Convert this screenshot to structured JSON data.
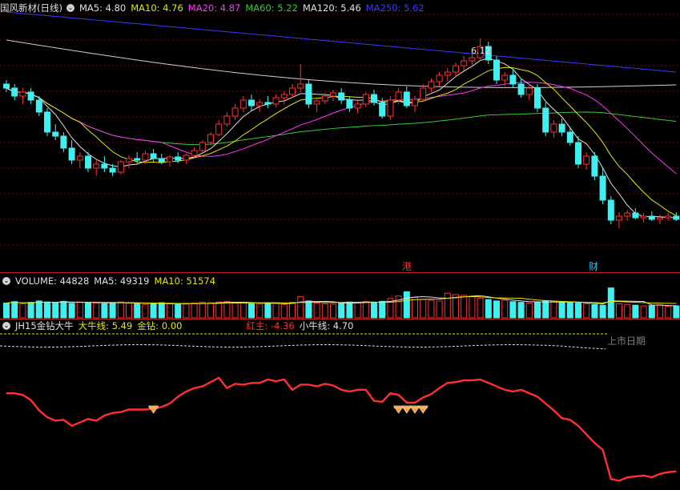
{
  "main": {
    "stock_title": "国风新材(日线)",
    "ma_items": [
      {
        "label": "MA5: 4.80",
        "color": "#e0e0e0"
      },
      {
        "label": "MA10: 4.76",
        "color": "#e6e600"
      },
      {
        "label": "MA20: 4.87",
        "color": "#ff33ff"
      },
      {
        "label": "MA60: 5.22",
        "color": "#33cc33"
      },
      {
        "label": "MA120: 5.46",
        "color": "#e0e0e0"
      },
      {
        "label": "MA250: 5.62",
        "color": "#3a3aff"
      }
    ],
    "price_annotation": "6.12",
    "event_markers": [
      {
        "text": "港",
        "color": "#ff3030",
        "x": 508
      },
      {
        "text": "财",
        "color": "#20c0ff",
        "x": 741
      }
    ]
  },
  "volume": {
    "items": [
      {
        "label": "VOLUME: 44828",
        "color": "#e0e0e0"
      },
      {
        "label": "MA5: 49319",
        "color": "#e0e0e0"
      },
      {
        "label": "MA10: 51574",
        "color": "#e6e600"
      }
    ]
  },
  "indicator": {
    "title": "JH15金钻大牛",
    "items": [
      {
        "label": "大牛线: 5.49",
        "color": "#e6e600"
      },
      {
        "label": "金钻: 0.00",
        "color": "#e6e600"
      },
      {
        "label": "红主: -4.36",
        "color": "#ff3030"
      },
      {
        "label": "小牛线: 4.70",
        "color": "#e0e0e0"
      }
    ],
    "listing_label": "上市日期"
  },
  "colors": {
    "up": "#ff3030",
    "down": "#40f0f0",
    "grid": "#8b0000",
    "separator": "#c02020"
  },
  "chart_data": [
    {
      "type": "candlestick",
      "title": "国风新材(日线)",
      "note": "daily candles, values in price units (yuan); index = trading day",
      "ohlc": [
        [
          5.55,
          5.6,
          5.45,
          5.5
        ],
        [
          5.5,
          5.55,
          5.35,
          5.4
        ],
        [
          5.4,
          5.5,
          5.3,
          5.45
        ],
        [
          5.45,
          5.5,
          5.3,
          5.35
        ],
        [
          5.35,
          5.4,
          5.15,
          5.2
        ],
        [
          5.2,
          5.25,
          4.9,
          4.95
        ],
        [
          4.95,
          5.05,
          4.85,
          4.9
        ],
        [
          4.9,
          4.95,
          4.7,
          4.75
        ],
        [
          4.75,
          4.85,
          4.55,
          4.6
        ],
        [
          4.6,
          4.7,
          4.5,
          4.65
        ],
        [
          4.65,
          4.7,
          4.45,
          4.5
        ],
        [
          4.5,
          4.6,
          4.4,
          4.55
        ],
        [
          4.55,
          4.65,
          4.45,
          4.5
        ],
        [
          4.5,
          4.55,
          4.4,
          4.45
        ],
        [
          4.45,
          4.6,
          4.42,
          4.58
        ],
        [
          4.58,
          4.66,
          4.5,
          4.62
        ],
        [
          4.62,
          4.7,
          4.55,
          4.6
        ],
        [
          4.6,
          4.72,
          4.55,
          4.68
        ],
        [
          4.68,
          4.74,
          4.58,
          4.62
        ],
        [
          4.62,
          4.68,
          4.55,
          4.58
        ],
        [
          4.58,
          4.66,
          4.52,
          4.64
        ],
        [
          4.64,
          4.7,
          4.56,
          4.6
        ],
        [
          4.6,
          4.68,
          4.55,
          4.66
        ],
        [
          4.66,
          4.76,
          4.62,
          4.72
        ],
        [
          4.72,
          4.85,
          4.7,
          4.82
        ],
        [
          4.82,
          4.95,
          4.8,
          4.92
        ],
        [
          4.92,
          5.1,
          4.9,
          5.05
        ],
        [
          5.05,
          5.2,
          5.02,
          5.15
        ],
        [
          5.15,
          5.3,
          5.1,
          5.25
        ],
        [
          5.25,
          5.4,
          5.2,
          5.35
        ],
        [
          5.35,
          5.42,
          5.22,
          5.28
        ],
        [
          5.28,
          5.36,
          5.2,
          5.32
        ],
        [
          5.32,
          5.4,
          5.25,
          5.3
        ],
        [
          5.3,
          5.42,
          5.26,
          5.38
        ],
        [
          5.38,
          5.46,
          5.3,
          5.42
        ],
        [
          5.42,
          5.55,
          5.38,
          5.5
        ],
        [
          5.5,
          5.8,
          5.45,
          5.55
        ],
        [
          5.55,
          5.6,
          5.25,
          5.3
        ],
        [
          5.3,
          5.38,
          5.2,
          5.34
        ],
        [
          5.34,
          5.44,
          5.3,
          5.4
        ],
        [
          5.4,
          5.48,
          5.34,
          5.44
        ],
        [
          5.44,
          5.5,
          5.3,
          5.35
        ],
        [
          5.35,
          5.4,
          5.2,
          5.25
        ],
        [
          5.25,
          5.34,
          5.18,
          5.3
        ],
        [
          5.3,
          5.45,
          5.26,
          5.42
        ],
        [
          5.42,
          5.48,
          5.28,
          5.32
        ],
        [
          5.32,
          5.38,
          5.12,
          5.15
        ],
        [
          5.15,
          5.4,
          5.1,
          5.35
        ],
        [
          5.35,
          5.5,
          5.3,
          5.45
        ],
        [
          5.45,
          5.52,
          5.25,
          5.28
        ],
        [
          5.28,
          5.4,
          5.2,
          5.36
        ],
        [
          5.36,
          5.55,
          5.34,
          5.5
        ],
        [
          5.5,
          5.62,
          5.45,
          5.58
        ],
        [
          5.58,
          5.7,
          5.52,
          5.66
        ],
        [
          5.66,
          5.75,
          5.58,
          5.7
        ],
        [
          5.7,
          5.82,
          5.64,
          5.78
        ],
        [
          5.78,
          5.9,
          5.72,
          5.84
        ],
        [
          5.84,
          5.95,
          5.76,
          5.88
        ],
        [
          5.88,
          6.12,
          5.84,
          6.02
        ],
        [
          6.02,
          6.08,
          5.8,
          5.85
        ],
        [
          5.85,
          5.9,
          5.55,
          5.6
        ],
        [
          5.6,
          5.7,
          5.52,
          5.66
        ],
        [
          5.66,
          5.74,
          5.5,
          5.55
        ],
        [
          5.55,
          5.62,
          5.38,
          5.42
        ],
        [
          5.42,
          5.55,
          5.35,
          5.5
        ],
        [
          5.5,
          5.55,
          5.2,
          5.25
        ],
        [
          5.25,
          5.32,
          4.9,
          4.95
        ],
        [
          4.95,
          5.1,
          4.88,
          5.05
        ],
        [
          5.05,
          5.12,
          4.9,
          4.95
        ],
        [
          4.95,
          5.02,
          4.78,
          4.82
        ],
        [
          4.82,
          4.9,
          4.5,
          4.55
        ],
        [
          4.55,
          4.7,
          4.48,
          4.65
        ],
        [
          4.65,
          4.7,
          4.35,
          4.4
        ],
        [
          4.4,
          4.5,
          4.05,
          4.1
        ],
        [
          4.1,
          4.15,
          3.8,
          3.85
        ],
        [
          3.85,
          3.95,
          3.75,
          3.9
        ],
        [
          3.9,
          3.98,
          3.84,
          3.94
        ],
        [
          3.94,
          4.0,
          3.86,
          3.88
        ],
        [
          3.88,
          3.94,
          3.82,
          3.9
        ],
        [
          3.9,
          3.96,
          3.84,
          3.86
        ],
        [
          3.86,
          3.92,
          3.8,
          3.88
        ],
        [
          3.88,
          3.94,
          3.84,
          3.9
        ],
        [
          3.9,
          3.95,
          3.84,
          3.86
        ]
      ],
      "ylim": [
        3.2,
        6.6
      ]
    },
    {
      "type": "bar",
      "title": "VOLUME",
      "values": [
        42,
        46,
        40,
        44,
        48,
        45,
        43,
        47,
        41,
        45,
        44,
        42,
        40,
        43,
        45,
        42,
        40,
        38,
        41,
        43,
        40,
        38,
        39,
        42,
        44,
        43,
        45,
        47,
        42,
        44,
        40,
        39,
        43,
        41,
        38,
        44,
        60,
        48,
        42,
        40,
        39,
        43,
        45,
        44,
        46,
        42,
        47,
        55,
        62,
        74,
        58,
        52,
        50,
        48,
        70,
        66,
        64,
        60,
        56,
        52,
        48,
        50,
        46,
        44,
        42,
        45,
        48,
        46,
        44,
        43,
        42,
        40,
        38,
        36,
        85,
        40,
        38,
        36,
        34,
        35,
        37,
        33,
        34
      ],
      "ylim": [
        0,
        100
      ]
    },
    {
      "type": "line",
      "title": "JH15金钻大牛",
      "series": [
        {
          "name": "红主",
          "values": [
            10,
            10,
            8,
            2,
            -10,
            -18,
            -22,
            -21,
            -28,
            -24,
            -20,
            -22,
            -16,
            -13,
            -12,
            -9,
            -9,
            -9,
            -8,
            -6,
            -2,
            6,
            12,
            16,
            18,
            23,
            28,
            16,
            21,
            20,
            22,
            22,
            26,
            24,
            26,
            14,
            20,
            20,
            18,
            21,
            19,
            14,
            12,
            14,
            14,
            1,
            0,
            10,
            8,
            -1,
            -1,
            5,
            9,
            16,
            22,
            23,
            25,
            25,
            26,
            22,
            18,
            14,
            12,
            14,
            10,
            6,
            -2,
            -10,
            -19,
            -21,
            -28,
            -38,
            -48,
            -56,
            -90,
            -92,
            -88,
            -87,
            -86,
            -88,
            -84,
            -82,
            -81
          ]
        }
      ],
      "gold_markers_at": [
        18,
        48,
        49,
        50,
        51
      ],
      "ylim": [
        -100,
        40
      ]
    }
  ]
}
